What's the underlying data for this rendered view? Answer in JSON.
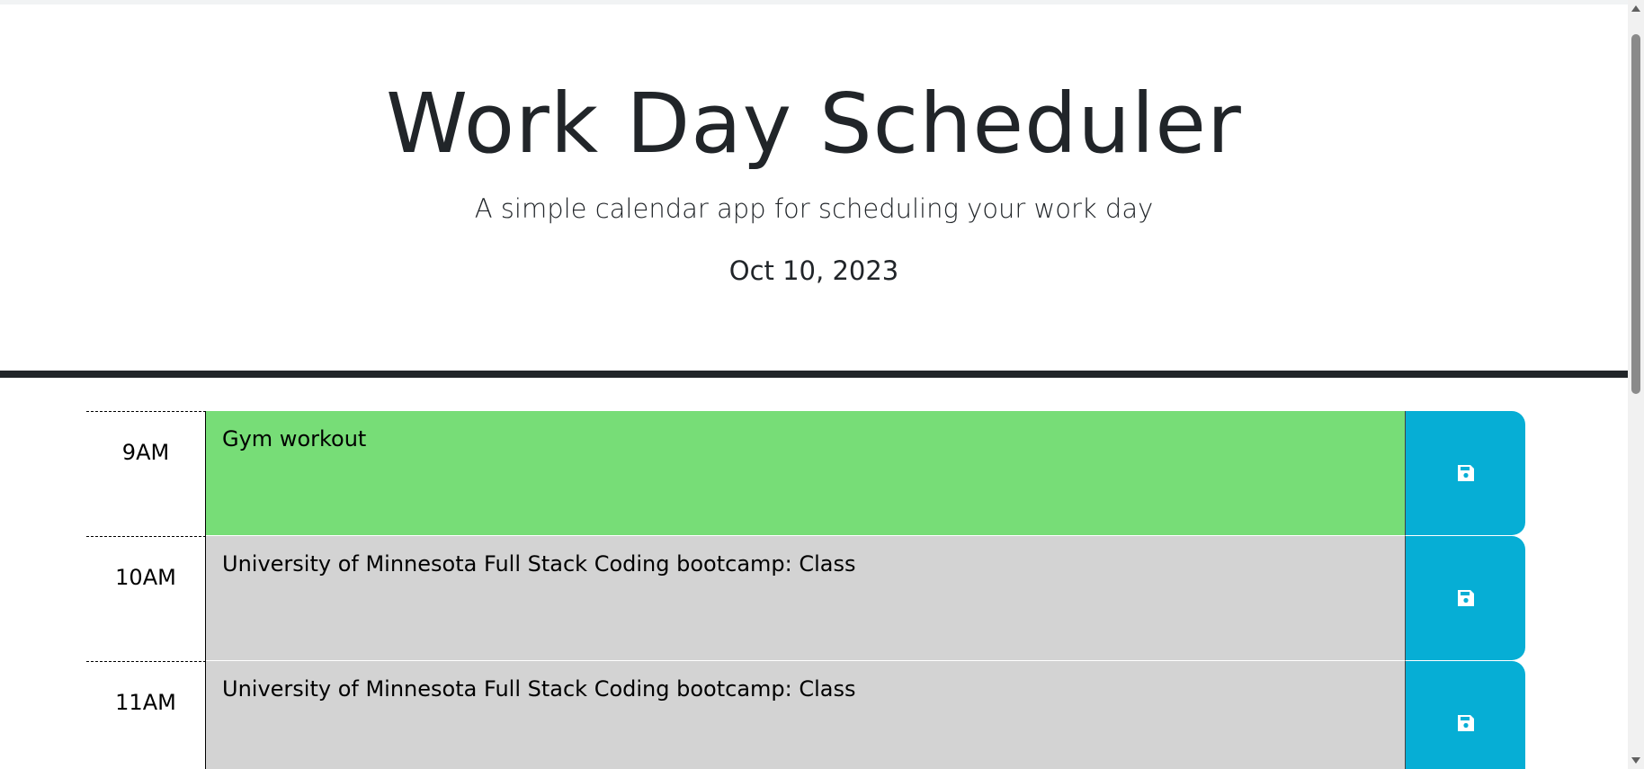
{
  "header": {
    "title": "Work Day Scheduler",
    "lead": "A simple calendar app for scheduling your work day",
    "date": "Oct 10, 2023"
  },
  "colors": {
    "present": "#77dd77",
    "past": "#d3d3d3",
    "save_button": "#06aed5",
    "divider": "#212529"
  },
  "rows": [
    {
      "hour": "9AM",
      "text": "Gym workout",
      "state": "present",
      "save_icon": "save-icon"
    },
    {
      "hour": "10AM",
      "text": "University of Minnesota Full Stack Coding bootcamp: Class",
      "state": "past",
      "save_icon": "save-icon"
    },
    {
      "hour": "11AM",
      "text": "University of Minnesota Full Stack Coding bootcamp: Class",
      "state": "past",
      "save_icon": "save-icon"
    }
  ]
}
